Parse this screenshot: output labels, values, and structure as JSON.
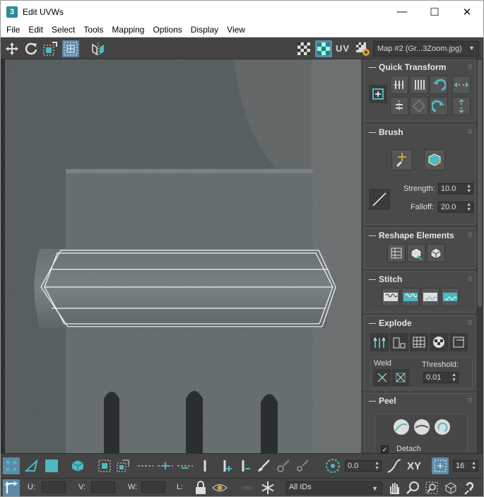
{
  "window": {
    "app_icon": "3",
    "title": "Edit UVWs",
    "minimize": "—",
    "maximize": "☐",
    "close": "✕"
  },
  "menu": [
    "File",
    "Edit",
    "Select",
    "Tools",
    "Mapping",
    "Options",
    "Display",
    "View"
  ],
  "toolbar": {
    "uv_label": "UV",
    "map_select": "Map #2 (Gr...3Zoom.jpg)"
  },
  "panel": {
    "quick_transform": {
      "title": "Quick Transform"
    },
    "brush": {
      "title": "Brush",
      "strength_label": "Strength:",
      "strength_value": "10.0",
      "falloff_label": "Falloff:",
      "falloff_value": "20.0"
    },
    "reshape": {
      "title": "Reshape Elements"
    },
    "stitch": {
      "title": "Stitch"
    },
    "explode": {
      "title": "Explode",
      "weld_label": "Weld",
      "threshold_label": "Threshold:",
      "threshold_value": "0.01"
    },
    "peel": {
      "title": "Peel",
      "detach_label": "Detach",
      "detach_checked": true
    }
  },
  "bottom": {
    "angle_value": "0.0",
    "xy_label": "XY",
    "snap_value": "16",
    "u_label": "U:",
    "v_label": "V:",
    "w_label": "W:",
    "l_label": "L:",
    "ids_select": "All IDs"
  },
  "colors": {
    "accent": "#4fb8c0",
    "active_button": "#5d8aa8",
    "panel_bg": "#444444"
  }
}
